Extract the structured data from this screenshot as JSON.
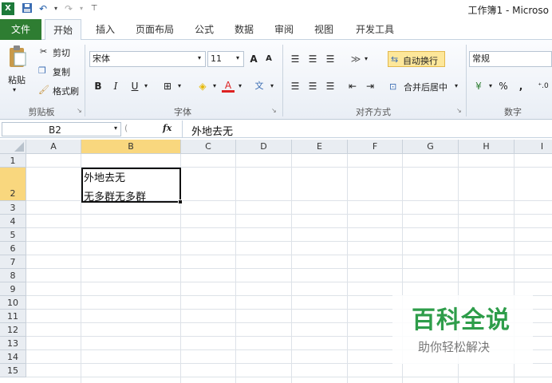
{
  "title_bar": {
    "title": "工作簿1 - Microso",
    "qa_icons": [
      "excel-icon",
      "save-icon",
      "undo-icon",
      "redo-icon",
      "customize-icon"
    ]
  },
  "tabs": [
    {
      "label": "文件"
    },
    {
      "label": "开始"
    },
    {
      "label": "插入"
    },
    {
      "label": "页面布局"
    },
    {
      "label": "公式"
    },
    {
      "label": "数据"
    },
    {
      "label": "审阅"
    },
    {
      "label": "视图"
    },
    {
      "label": "开发工具"
    }
  ],
  "ribbon": {
    "clipboard": {
      "paste": "粘贴",
      "cut": "剪切",
      "copy": "复制",
      "format_painter": "格式刷",
      "label": "剪贴板"
    },
    "font": {
      "name": "宋体",
      "size": "11",
      "grow": "A",
      "shrink": "A",
      "bold": "B",
      "italic": "I",
      "underline": "U",
      "label": "字体"
    },
    "alignment": {
      "wrap": "自动换行",
      "merge": "合并后居中",
      "label": "对齐方式"
    },
    "number": {
      "format": "常规",
      "percent": "%",
      "comma": ",",
      "label": "数字"
    }
  },
  "formula_bar": {
    "name_box": "B2",
    "fx": "fx",
    "content": "外地去无"
  },
  "grid": {
    "columns": [
      "A",
      "B",
      "C",
      "D",
      "E",
      "F",
      "G",
      "H",
      "I"
    ],
    "rows": [
      "1",
      "2",
      "3",
      "4",
      "5",
      "6",
      "7",
      "8",
      "9",
      "10",
      "11",
      "12",
      "13",
      "14",
      "15"
    ],
    "selected_cell": "B2",
    "cell_b2_line1": "外地去无",
    "cell_b2_line2": "无多群无多群"
  },
  "watermark": {
    "main": "百科全说",
    "sub": "助你轻松解决"
  },
  "colors": {
    "file_tab": "#2e7d32",
    "selection_header": "#f9d77e",
    "watermark": "#2e9d4a"
  }
}
